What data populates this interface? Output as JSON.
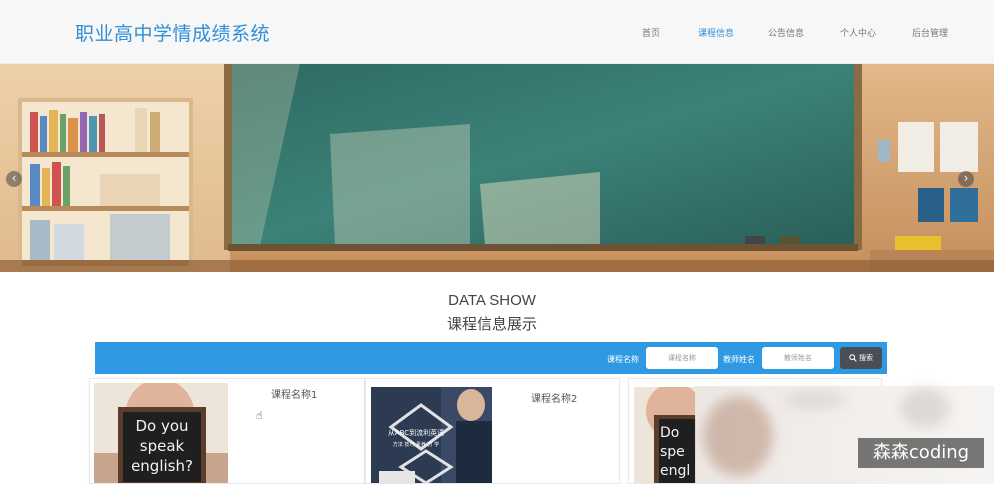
{
  "header": {
    "logo": "职业高中学情成绩系统",
    "nav": [
      {
        "label": "首页"
      },
      {
        "label": "课程信息"
      },
      {
        "label": "公告信息"
      },
      {
        "label": "个人中心"
      },
      {
        "label": "后台管理"
      }
    ],
    "active_nav": "课程信息"
  },
  "banner": {
    "prev_icon": "chevron-left-icon",
    "next_icon": "chevron-right-icon",
    "prev_glyph": "‹",
    "next_glyph": "›"
  },
  "section": {
    "title_en": "DATA SHOW",
    "title_cn": "课程信息展示"
  },
  "search": {
    "course_label": "课程名称",
    "course_placeholder": "课程名称",
    "teacher_label": "教师姓名",
    "teacher_placeholder": "教师姓名",
    "button_label": "搜索",
    "button_icon": "search-icon"
  },
  "cards": [
    {
      "title": "课程名称1",
      "image_text": [
        "Do you",
        "speak",
        "english?"
      ]
    },
    {
      "title": "课程名称2",
      "image_text": [
        "从ABC到流利英语",
        "方法 技巧 素养 方 学"
      ]
    },
    {
      "title": "",
      "image_text": [
        "Do",
        "spe",
        "engl"
      ]
    }
  ],
  "watermark": "森森coding",
  "colors": {
    "accent": "#2f8fd8",
    "search_bar": "#2f9ae3",
    "search_button": "#4a4f55"
  }
}
